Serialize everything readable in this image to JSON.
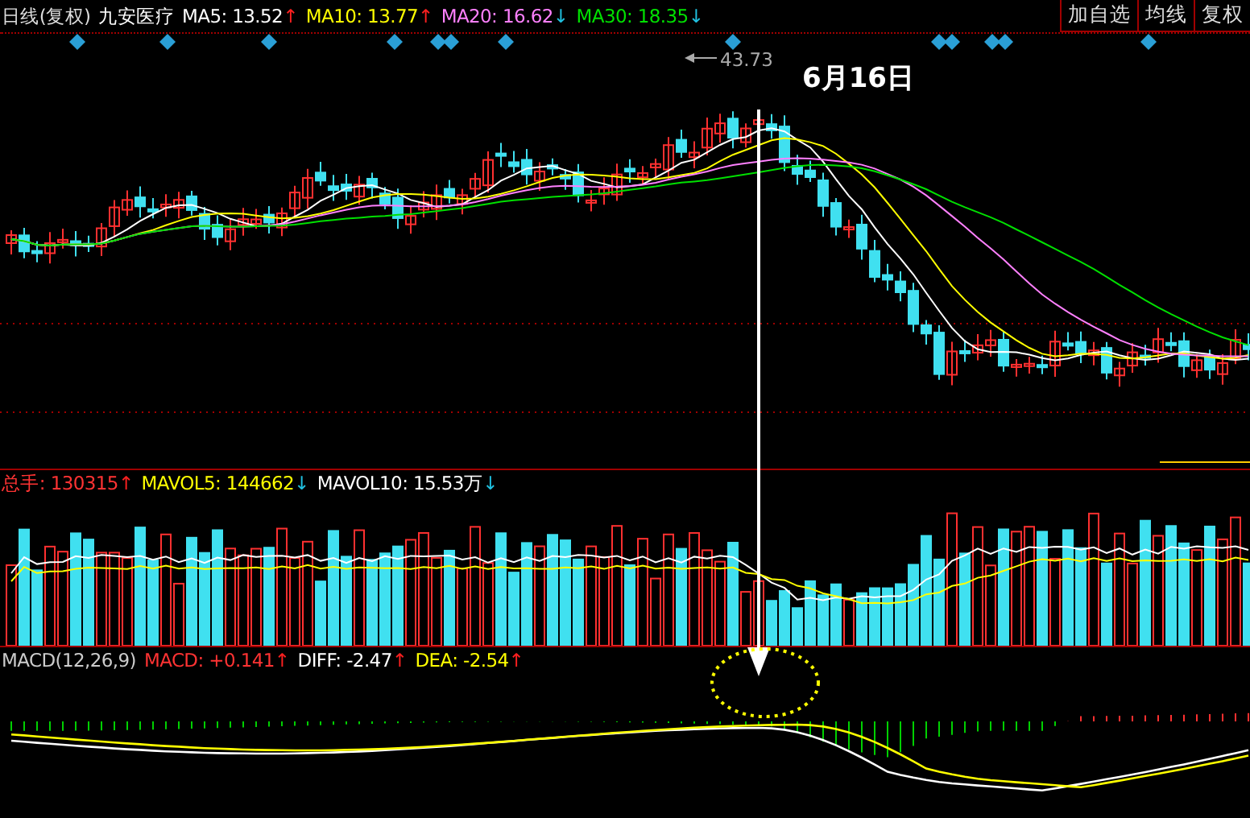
{
  "main_header": {
    "period": "日线(复权)",
    "stock_name": "九安医疗",
    "indicators": [
      {
        "label": "MA5:",
        "value": "13.52",
        "color": "#ffffff",
        "arrow": {
          "symbol": "↑",
          "color": "#ff2020"
        }
      },
      {
        "label": "MA10:",
        "value": "13.77",
        "color": "#ffff00",
        "arrow": {
          "symbol": "↑",
          "color": "#ff2020"
        }
      },
      {
        "label": "MA20:",
        "value": "16.62",
        "color": "#ff80ff",
        "arrow": {
          "symbol": "↓",
          "color": "#20c0e0"
        }
      },
      {
        "label": "MA30:",
        "value": "18.35",
        "color": "#00e000",
        "arrow": {
          "symbol": "↓",
          "color": "#20c0e0"
        }
      }
    ]
  },
  "toolbar_buttons": [
    "加自选",
    "均线",
    "复权"
  ],
  "high_price_label": "43.73",
  "date_annotation": "6月16日",
  "volume_header": {
    "indicators": [
      {
        "label": "总手:",
        "value": "130315",
        "color": "#ff3333",
        "arrow": {
          "symbol": "↑",
          "color": "#ff2020"
        }
      },
      {
        "label": "MAVOL5:",
        "value": "144662",
        "color": "#ffff00",
        "arrow": {
          "symbol": "↓",
          "color": "#20c0e0"
        }
      },
      {
        "label": "MAVOL10:",
        "value": "15.53万",
        "color": "#ffffff",
        "arrow": {
          "symbol": "↓",
          "color": "#20c0e0"
        }
      }
    ]
  },
  "macd_header": {
    "title": "MACD(12,26,9)",
    "indicators": [
      {
        "label": "MACD:",
        "value": "+0.141",
        "color": "#ff3333",
        "arrow": {
          "symbol": "↑",
          "color": "#ff2020"
        }
      },
      {
        "label": "DIFF:",
        "value": "-2.47",
        "color": "#ffffff",
        "arrow": {
          "symbol": "↑",
          "color": "#ff2020"
        }
      },
      {
        "label": "DEA:",
        "value": "-2.54",
        "color": "#ffff00",
        "arrow": {
          "symbol": "↑",
          "color": "#ff2020"
        }
      }
    ]
  }
}
